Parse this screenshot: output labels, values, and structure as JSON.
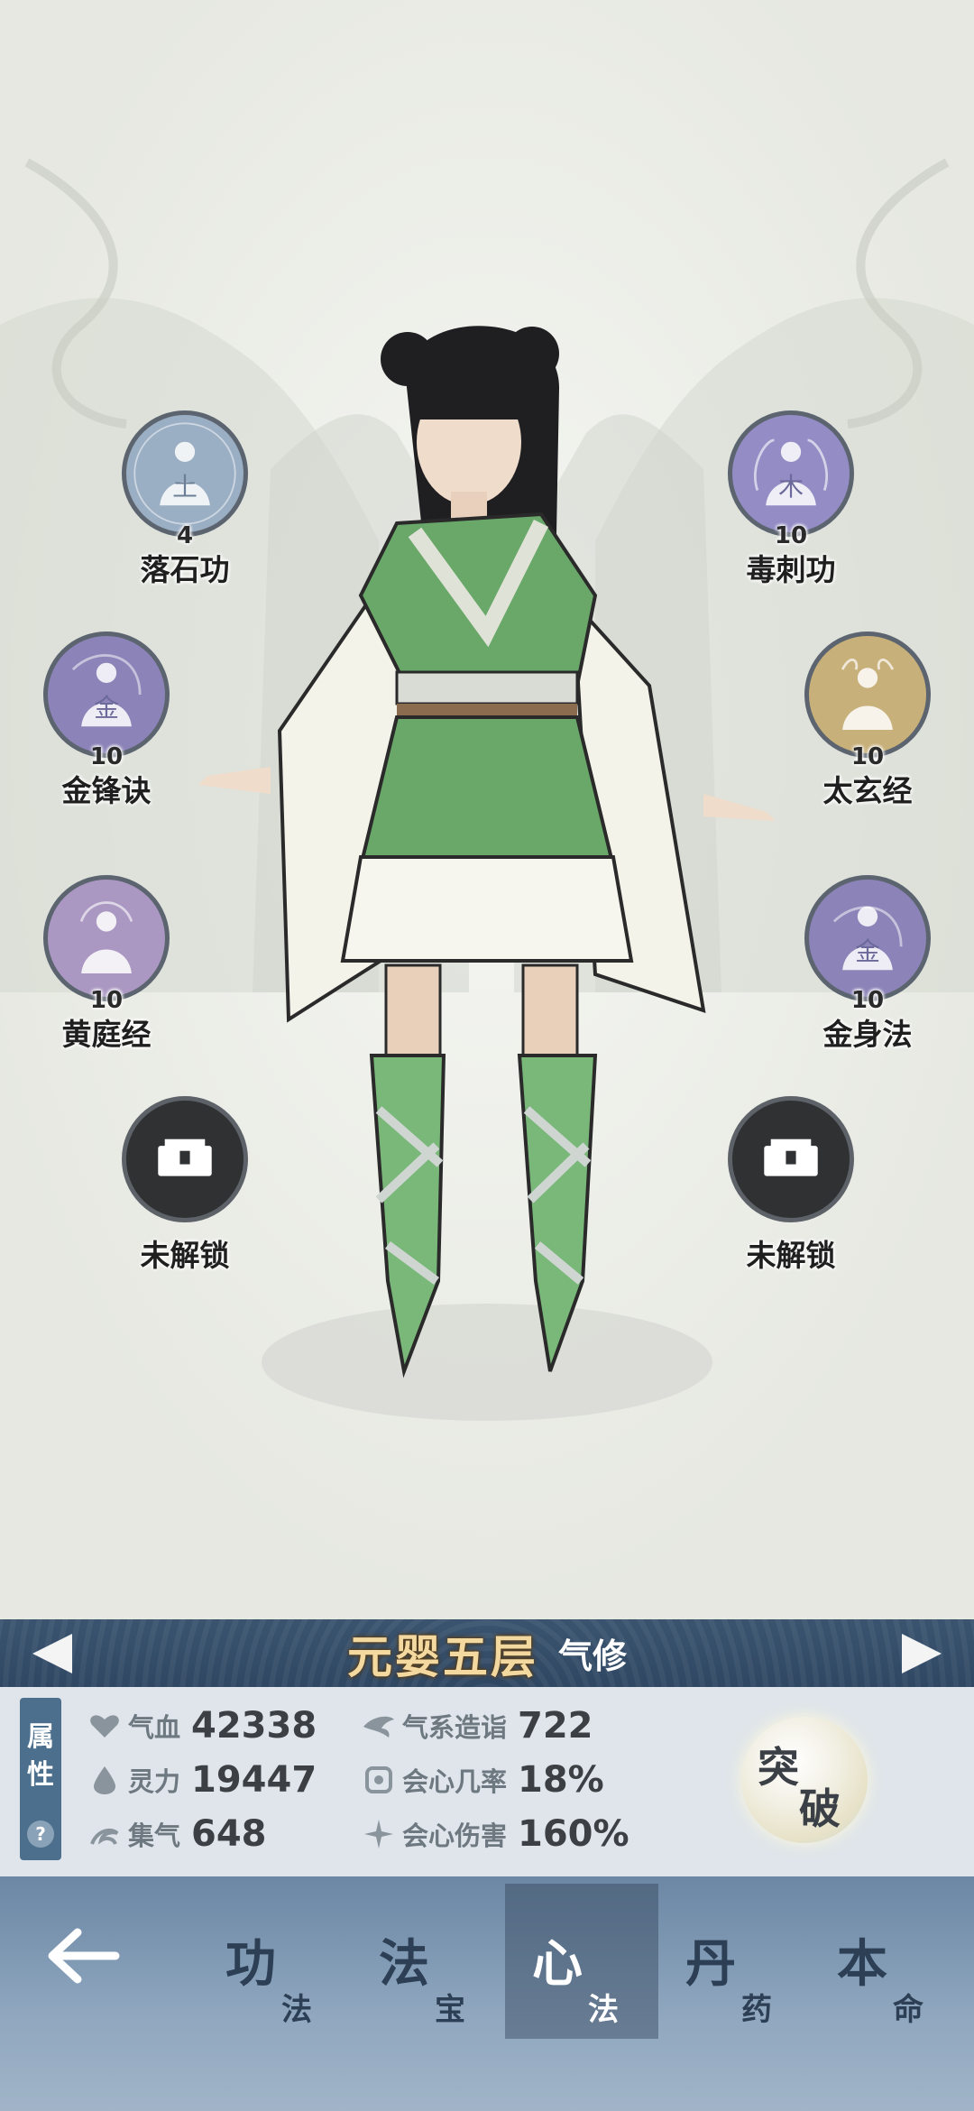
{
  "skills_left": [
    {
      "name": "落石功",
      "level": "4",
      "element": "土",
      "color": "#9aaec4"
    },
    {
      "name": "金锋诀",
      "level": "10",
      "element": "金",
      "color": "#8c84b8"
    },
    {
      "name": "黄庭经",
      "level": "10",
      "element": "",
      "color": "#ab98c2"
    },
    {
      "name": "未解锁",
      "level": "",
      "element": "",
      "color": "#303133"
    }
  ],
  "skills_right": [
    {
      "name": "毒刺功",
      "level": "10",
      "element": "木",
      "color": "#948dc5"
    },
    {
      "name": "太玄经",
      "level": "10",
      "element": "",
      "color": "#c8b07a"
    },
    {
      "name": "金身法",
      "level": "10",
      "element": "金",
      "color": "#8c84b8"
    },
    {
      "name": "未解锁",
      "level": "",
      "element": "",
      "color": "#303133"
    }
  ],
  "realm": {
    "title": "元婴五层",
    "type": "气修"
  },
  "attributes": {
    "tab_label_1": "属",
    "tab_label_2": "性",
    "help": "?",
    "stats_left": [
      {
        "icon": "heart-icon",
        "label": "气血",
        "value": "42338"
      },
      {
        "icon": "drop-icon",
        "label": "灵力",
        "value": "19447"
      },
      {
        "icon": "swirl-icon",
        "label": "集气",
        "value": "648"
      }
    ],
    "stats_right": [
      {
        "icon": "wing-icon",
        "label": "气系造诣",
        "value": "722"
      },
      {
        "icon": "crit-rate-icon",
        "label": "会心几率",
        "value": "18%"
      },
      {
        "icon": "crit-damage-icon",
        "label": "会心伤害",
        "value": "160%"
      }
    ]
  },
  "breakthrough": {
    "char1": "突",
    "char2": "破"
  },
  "nav": [
    {
      "big": "功",
      "small": "法"
    },
    {
      "big": "法",
      "small": "宝"
    },
    {
      "big": "心",
      "small": "法"
    },
    {
      "big": "丹",
      "small": "药"
    },
    {
      "big": "本",
      "small": "命"
    }
  ],
  "colors": {
    "accent": "#3a5470",
    "panel": "#dfe5ea",
    "realm_title": "#f3d9a0"
  }
}
